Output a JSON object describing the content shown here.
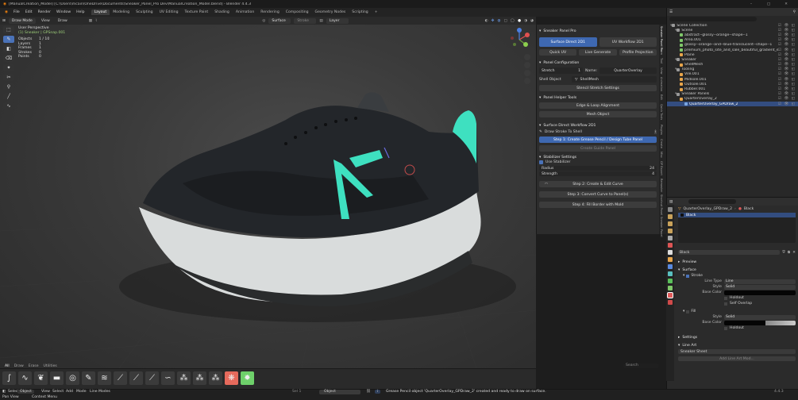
{
  "window": {
    "title": "[ManualCreation_Model] [C:\\Users\\mcain\\OneDrive\\Documents\\Sneaker_Panel_Pro Dev\\ManualCreation_Model.blend] - Blender 4.4.3",
    "controls": [
      "–",
      "▢",
      "✕"
    ]
  },
  "menu": [
    "File",
    "Edit",
    "Render",
    "Window",
    "Help"
  ],
  "workspaces": [
    {
      "label": "Layout",
      "active": true
    },
    {
      "label": "Modeling"
    },
    {
      "label": "Sculpting"
    },
    {
      "label": "UV Editing"
    },
    {
      "label": "Texture Paint"
    },
    {
      "label": "Shading"
    },
    {
      "label": "Animation"
    },
    {
      "label": "Rendering"
    },
    {
      "label": "Compositing"
    },
    {
      "label": "Geometry Nodes"
    },
    {
      "label": "Scripting"
    },
    {
      "label": "+"
    }
  ],
  "topright": {
    "scene": "Scene",
    "viewlayer": "ViewLayer"
  },
  "viewport_header": {
    "mode": "Draw Mode",
    "view": "View",
    "draw": "Draw",
    "surface": "Surface",
    "layer": "Layer",
    "stroke": "Stroke"
  },
  "overlay": {
    "title": "User Perspective",
    "subtitle": "(1) Sneaker | GPSnap.001",
    "rows": [
      {
        "k": "Objects",
        "v": "1 / 10"
      },
      {
        "k": "Layers",
        "v": "1"
      },
      {
        "k": "Frames",
        "v": "1"
      },
      {
        "k": "Strokes",
        "v": "0"
      },
      {
        "k": "Points",
        "v": "0"
      }
    ]
  },
  "gizmo": {
    "x": "X",
    "y": "Y",
    "z": "Z"
  },
  "npanel": {
    "header": "Sneaker Panel Pro",
    "surface_direct": "Surface Direct 2D1",
    "workflow": "UV Workflow 2D1",
    "quick_uv": "Quick UV",
    "live_generate": "Live Generate",
    "profile_projection": "Profile Projection",
    "panel_config": "Panel Configuration",
    "stretch_label": "Stretch",
    "stretch_value": "1",
    "name_label": "Name:",
    "name_value": "QuarterOverlay",
    "shell_label": "Shell Object",
    "shell_value": "ShellMesh",
    "stencil_settings": "Stencil Stretch Settings",
    "helper_header": "Panel Helper Tools",
    "edge_loop": "Edge & Loop Alignment",
    "mesh_object": "Mesh Object",
    "direct_header": "Surface Direct Workflow 2D1",
    "draw_stroke": "Draw Stroke To Shell",
    "step1": "Step 1: Create Grease Pencil / Design Tube Panel",
    "create_guide": "Create Guide Panel",
    "stabilizer": "Stabilizer Settings",
    "use_stab": "Use Stabilizer",
    "radius_label": "Radius",
    "radius_value": "24",
    "strength_label": "Strength",
    "strength_value": "4",
    "step2": "Step 2: Create & Edit Curve",
    "step3": "Step 3: Convert Curve to Panel(s)",
    "step4": "Step 4: Fill Border with Mold"
  },
  "vtabs": [
    "Sneaker Panel Pro",
    "Item",
    "Tool",
    "View",
    "Animation",
    "Edit",
    "Quick Tools",
    "Plugins",
    "Create",
    "Misc",
    "GP Export",
    "Remaster",
    "Shortcut Panel",
    "Sneaker Panel"
  ],
  "outliner": {
    "search": "",
    "rows": [
      {
        "t": "Scene Collection",
        "d": 0,
        "c": "#9a9a9a"
      },
      {
        "t": "Scene",
        "d": 1,
        "c": "#9a9a9a"
      },
      {
        "t": "abstract--glossy--orange--shape--1",
        "d": 2,
        "c": "#7fc86a"
      },
      {
        "t": "Area.001",
        "d": 2,
        "c": "#7fc86a"
      },
      {
        "t": "glossy--orange--and--blue-translucent--shape--1",
        "d": 2,
        "c": "#7fc86a"
      },
      {
        "t": "premium_photo_site_and_sale_beautiful_gradient_ex",
        "d": 2,
        "c": "#7fc86a"
      },
      {
        "t": "Plane",
        "d": 2,
        "c": "#e8a54a"
      },
      {
        "t": "Sneaker",
        "d": 1,
        "c": "#9a9a9a"
      },
      {
        "t": "ShellMesh",
        "d": 2,
        "c": "#e8a54a"
      },
      {
        "t": "Tooling",
        "d": 1,
        "c": "#9a9a9a"
      },
      {
        "t": "Vile.001",
        "d": 2,
        "c": "#e8a54a"
      },
      {
        "t": "Midsole.001",
        "d": 2,
        "c": "#e8a54a"
      },
      {
        "t": "Outsole.001",
        "d": 2,
        "c": "#e8a54a"
      },
      {
        "t": "Rubber.001",
        "d": 2,
        "c": "#e8a54a"
      },
      {
        "t": "Sneaker Panels",
        "d": 1,
        "c": "#9a9a9a"
      },
      {
        "t": "QuarterOverlay_2",
        "d": 2,
        "c": "#e8a54a"
      },
      {
        "t": "QuarterOverlay_GPDraw_2",
        "d": 3,
        "c": "#7aa6e0",
        "sel": true
      }
    ]
  },
  "properties": {
    "object": "QuarterOverlay_GPDraw_2",
    "layer": "Black",
    "slot": "Black",
    "material": "Black",
    "preview": "Preview",
    "surface": "Surface",
    "stroke": "Stroke",
    "line_type_label": "Line Type",
    "line_type": "Line",
    "style_label": "Style",
    "style": "Solid",
    "base_color_label": "Base Color",
    "holdout": "Holdout",
    "self_overlap": "Self Overlap",
    "fill": "Fill",
    "fill_style": "Solid",
    "fill_holdout": "Holdout",
    "settings": "Settings",
    "line_art": "Line Art",
    "custom": "Custom Props",
    "lineart_value": "Sneaker Sheet",
    "lineart_btn": "Add Line Art Mod..."
  },
  "assetshelf": {
    "tabs": [
      "All",
      "Draw",
      "Erase",
      "Utilities"
    ],
    "search": "Search"
  },
  "status": {
    "left": [
      "Select",
      "Object",
      "Pan View",
      "Context Menu"
    ],
    "mode": "Object",
    "menus": [
      "View",
      "Select",
      "Add",
      "Mode",
      "Line Modes"
    ],
    "message": "Grease Pencil object 'QuarterOverlay_GPDraw_2' created and ready to draw on surface.",
    "version": "4.4.3",
    "frame": "Sel 1"
  },
  "colors": {
    "accent": "#3e68b1",
    "selection": "#334d80",
    "panel": "#2c2c2c",
    "teal": "#3ee0c0"
  }
}
